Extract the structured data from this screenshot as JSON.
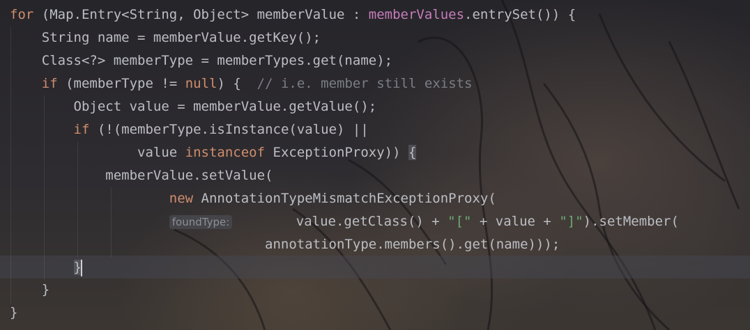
{
  "colors": {
    "keyword": "#cf8e6d",
    "field": "#c77dbb",
    "comment": "#7a7e85",
    "string": "#6aab73",
    "text": "#bcbec4",
    "hint": "#8c8f96"
  },
  "code": {
    "l1": {
      "kw": "for",
      "a": " (Map.Entry<String, Object> memberValue : ",
      "field": "memberValues",
      "b": ".entrySet()) {"
    },
    "l2": {
      "text": "    String name = memberValue.getKey();"
    },
    "l3": {
      "text": "    Class<?> memberType = memberTypes.get(name);"
    },
    "l4": {
      "indent": "    ",
      "kw1": "if",
      "a": " (memberType != ",
      "kw2": "null",
      "b": ") {  ",
      "comment": "// i.e. member still exists"
    },
    "l5": {
      "text": "        Object value = memberValue.getValue();"
    },
    "l6": {
      "indent": "        ",
      "kw": "if",
      "b": " (!(memberType.isInstance(value) ||"
    },
    "l7": {
      "indent": "                value ",
      "kw": "instanceof",
      "b": " ExceptionProxy)) ",
      "brace": "{"
    },
    "l8": {
      "text": "            memberValue.setValue("
    },
    "l9": {
      "indent": "                    ",
      "kw": "new",
      "b": " AnnotationTypeMismatchExceptionProxy("
    },
    "l10": {
      "indent": "                    ",
      "hint": "foundType:",
      "gap": "        ",
      "a": "value.getClass() + ",
      "s1": "\"[\"",
      "b": " + value + ",
      "s2": "\"]\"",
      "c": ").setMember("
    },
    "l11": {
      "text": "                                annotationType.members().get(name)));"
    },
    "l12": {
      "indent": "        ",
      "brace": "}"
    },
    "l13": {
      "text": "    }"
    },
    "l14": {
      "text": "}"
    }
  }
}
